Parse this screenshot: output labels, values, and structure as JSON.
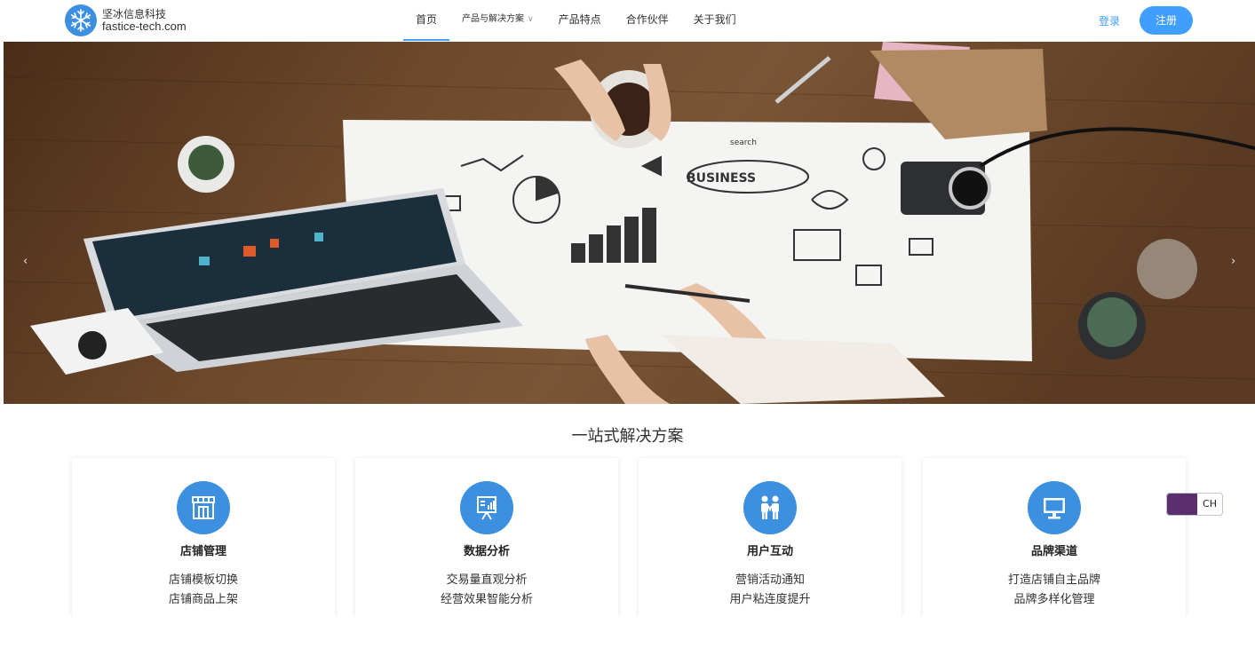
{
  "header": {
    "logo": {
      "name": "坚冰信息科技",
      "domain": "fastice-tech.com",
      "icon": "snowflake-icon"
    },
    "nav": [
      {
        "label": "首页",
        "active": true
      },
      {
        "label": "产品与解决方案",
        "dropdown": true
      },
      {
        "label": "产品特点"
      },
      {
        "label": "合作伙伴"
      },
      {
        "label": "关于我们"
      }
    ],
    "login_label": "登录",
    "register_label": "注册"
  },
  "banner": {
    "prev_icon": "‹",
    "next_icon": "›",
    "illustration_words": {
      "search": "search",
      "business": "BUSINESS"
    }
  },
  "solutions": {
    "title": "一站式解决方案",
    "cards": [
      {
        "icon": "storefront-icon",
        "title": "店铺管理",
        "lines": [
          "店铺模板切换",
          "店铺商品上架"
        ]
      },
      {
        "icon": "presentation-chart-icon",
        "title": "数据分析",
        "lines": [
          "交易量直观分析",
          "经营效果智能分析"
        ]
      },
      {
        "icon": "users-icon",
        "title": "用户互动",
        "lines": [
          "营销活动通知",
          "用户粘连度提升"
        ]
      },
      {
        "icon": "monitor-icon",
        "title": "品牌渠道",
        "lines": [
          "打造店铺自主品牌",
          "品牌多样化管理"
        ]
      }
    ]
  },
  "language_toggle": {
    "label": "CH"
  },
  "colors": {
    "accent": "#409eff",
    "icon_bg": "#3d8fe0",
    "toggle": "#5a2f6e"
  }
}
